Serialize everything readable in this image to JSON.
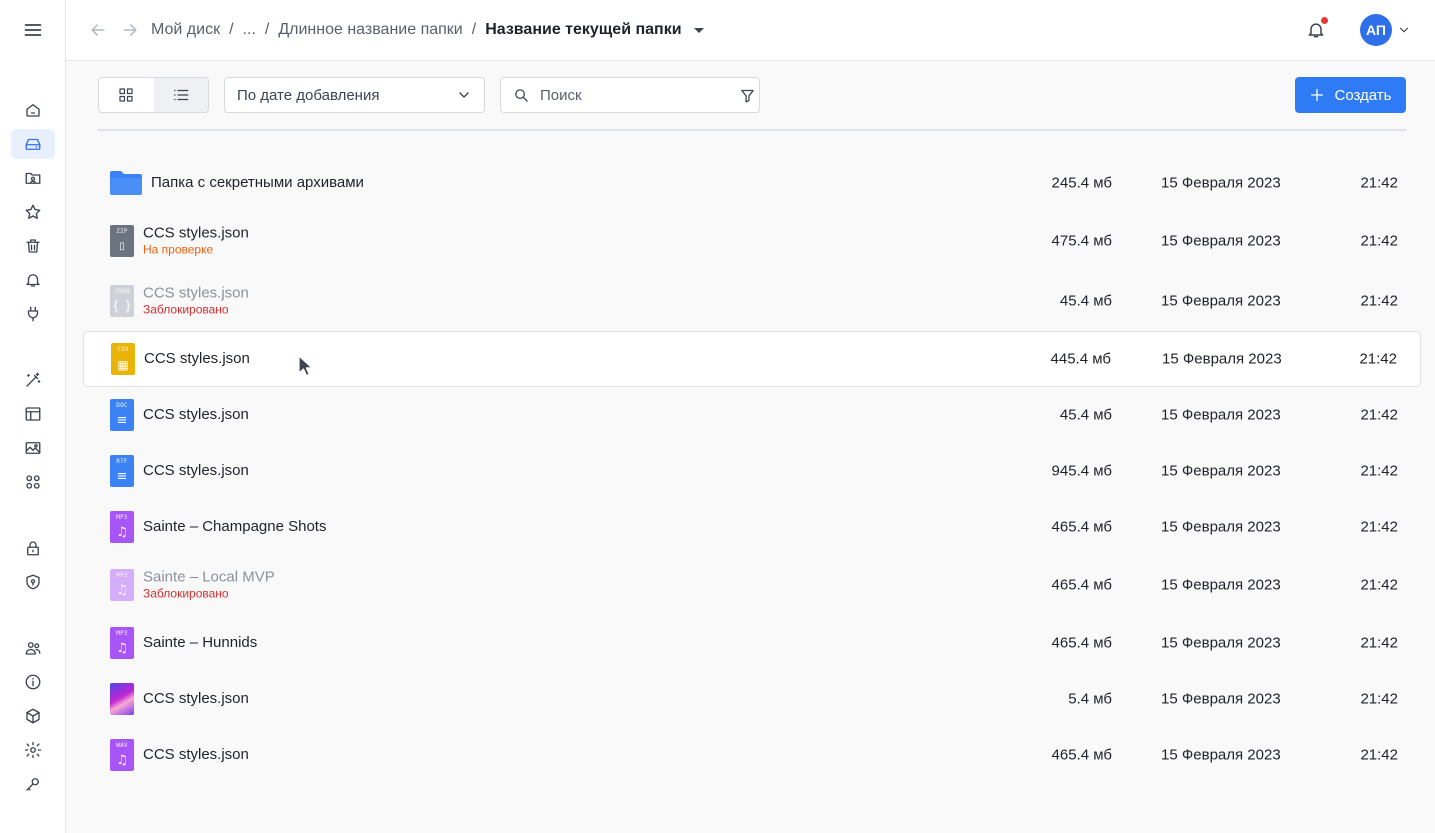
{
  "breadcrumb": {
    "root": "Мой диск",
    "ellipsis": "...",
    "parent": "Длинное название папки",
    "current": "Название текущей папки"
  },
  "user": {
    "initials": "АП"
  },
  "toolbar": {
    "sort_label": "По дате добавления",
    "search_placeholder": "Поиск",
    "create_label": "Создать"
  },
  "files": [
    {
      "name": "Папка с секретными архивами",
      "size": "245.4 мб",
      "date": "15 Февраля 2023",
      "time": "21:42",
      "status": ""
    },
    {
      "name": "CCS styles.json",
      "size": "475.4 мб",
      "date": "15 Февраля 2023",
      "time": "21:42",
      "status": "На проверке"
    },
    {
      "name": "CCS styles.json",
      "size": "45.4 мб",
      "date": "15 Февраля 2023",
      "time": "21:42",
      "status": "Заблокировано"
    },
    {
      "name": "CCS styles.json",
      "size": "445.4 мб",
      "date": "15 Февраля 2023",
      "time": "21:42",
      "status": ""
    },
    {
      "name": "CCS styles.json",
      "size": "45.4 мб",
      "date": "15 Февраля 2023",
      "time": "21:42",
      "status": ""
    },
    {
      "name": "CCS styles.json",
      "size": "945.4 мб",
      "date": "15 Февраля 2023",
      "time": "21:42",
      "status": ""
    },
    {
      "name": "Sainte – Champagne Shots",
      "size": "465.4 мб",
      "date": "15 Февраля 2023",
      "time": "21:42",
      "status": ""
    },
    {
      "name": "Sainte – Local MVP",
      "size": "465.4 мб",
      "date": "15 Февраля 2023",
      "time": "21:42",
      "status": "Заблокировано"
    },
    {
      "name": "Sainte – Hunnids",
      "size": "465.4 мб",
      "date": "15 Февраля 2023",
      "time": "21:42",
      "status": ""
    },
    {
      "name": "CCS styles.json",
      "size": "5.4 мб",
      "date": "15 Февраля 2023",
      "time": "21:42",
      "status": ""
    },
    {
      "name": "CCS styles.json",
      "size": "465.4 мб",
      "date": "15 Февраля 2023",
      "time": "21:42",
      "status": ""
    }
  ],
  "file_types": [
    "folder",
    "zip",
    "json",
    "csv",
    "doc",
    "rtf",
    "mp3",
    "mp3",
    "mp3",
    "image",
    "wav"
  ],
  "file_type_tags": {
    "zip": "ZIP",
    "json": "JSON",
    "csv": "CSV",
    "doc": "DOC",
    "rtf": "RTF",
    "mp3": "MP3",
    "wav": "WAV"
  },
  "colors": {
    "accent": "#2f7bf5",
    "folder": "#3b82f6",
    "zip": "#6b7280",
    "json": "#9ca3af",
    "csv": "#eab308",
    "doc": "#3b82f6",
    "rtf": "#3b82f6",
    "audio": "#a855f7",
    "status_review": "#e8650f",
    "status_blocked": "#d32f2f"
  },
  "sidebar_icons": [
    "home-icon",
    "drive-icon",
    "shared-folder-icon",
    "star-icon",
    "trash-icon",
    "bell-icon",
    "plug-icon",
    "magic-wand-icon",
    "layout-icon",
    "gallery-icon",
    "apps-icon",
    "lock-icon",
    "shield-icon",
    "users-icon",
    "info-icon",
    "cube-icon",
    "settings-icon",
    "key-icon"
  ]
}
